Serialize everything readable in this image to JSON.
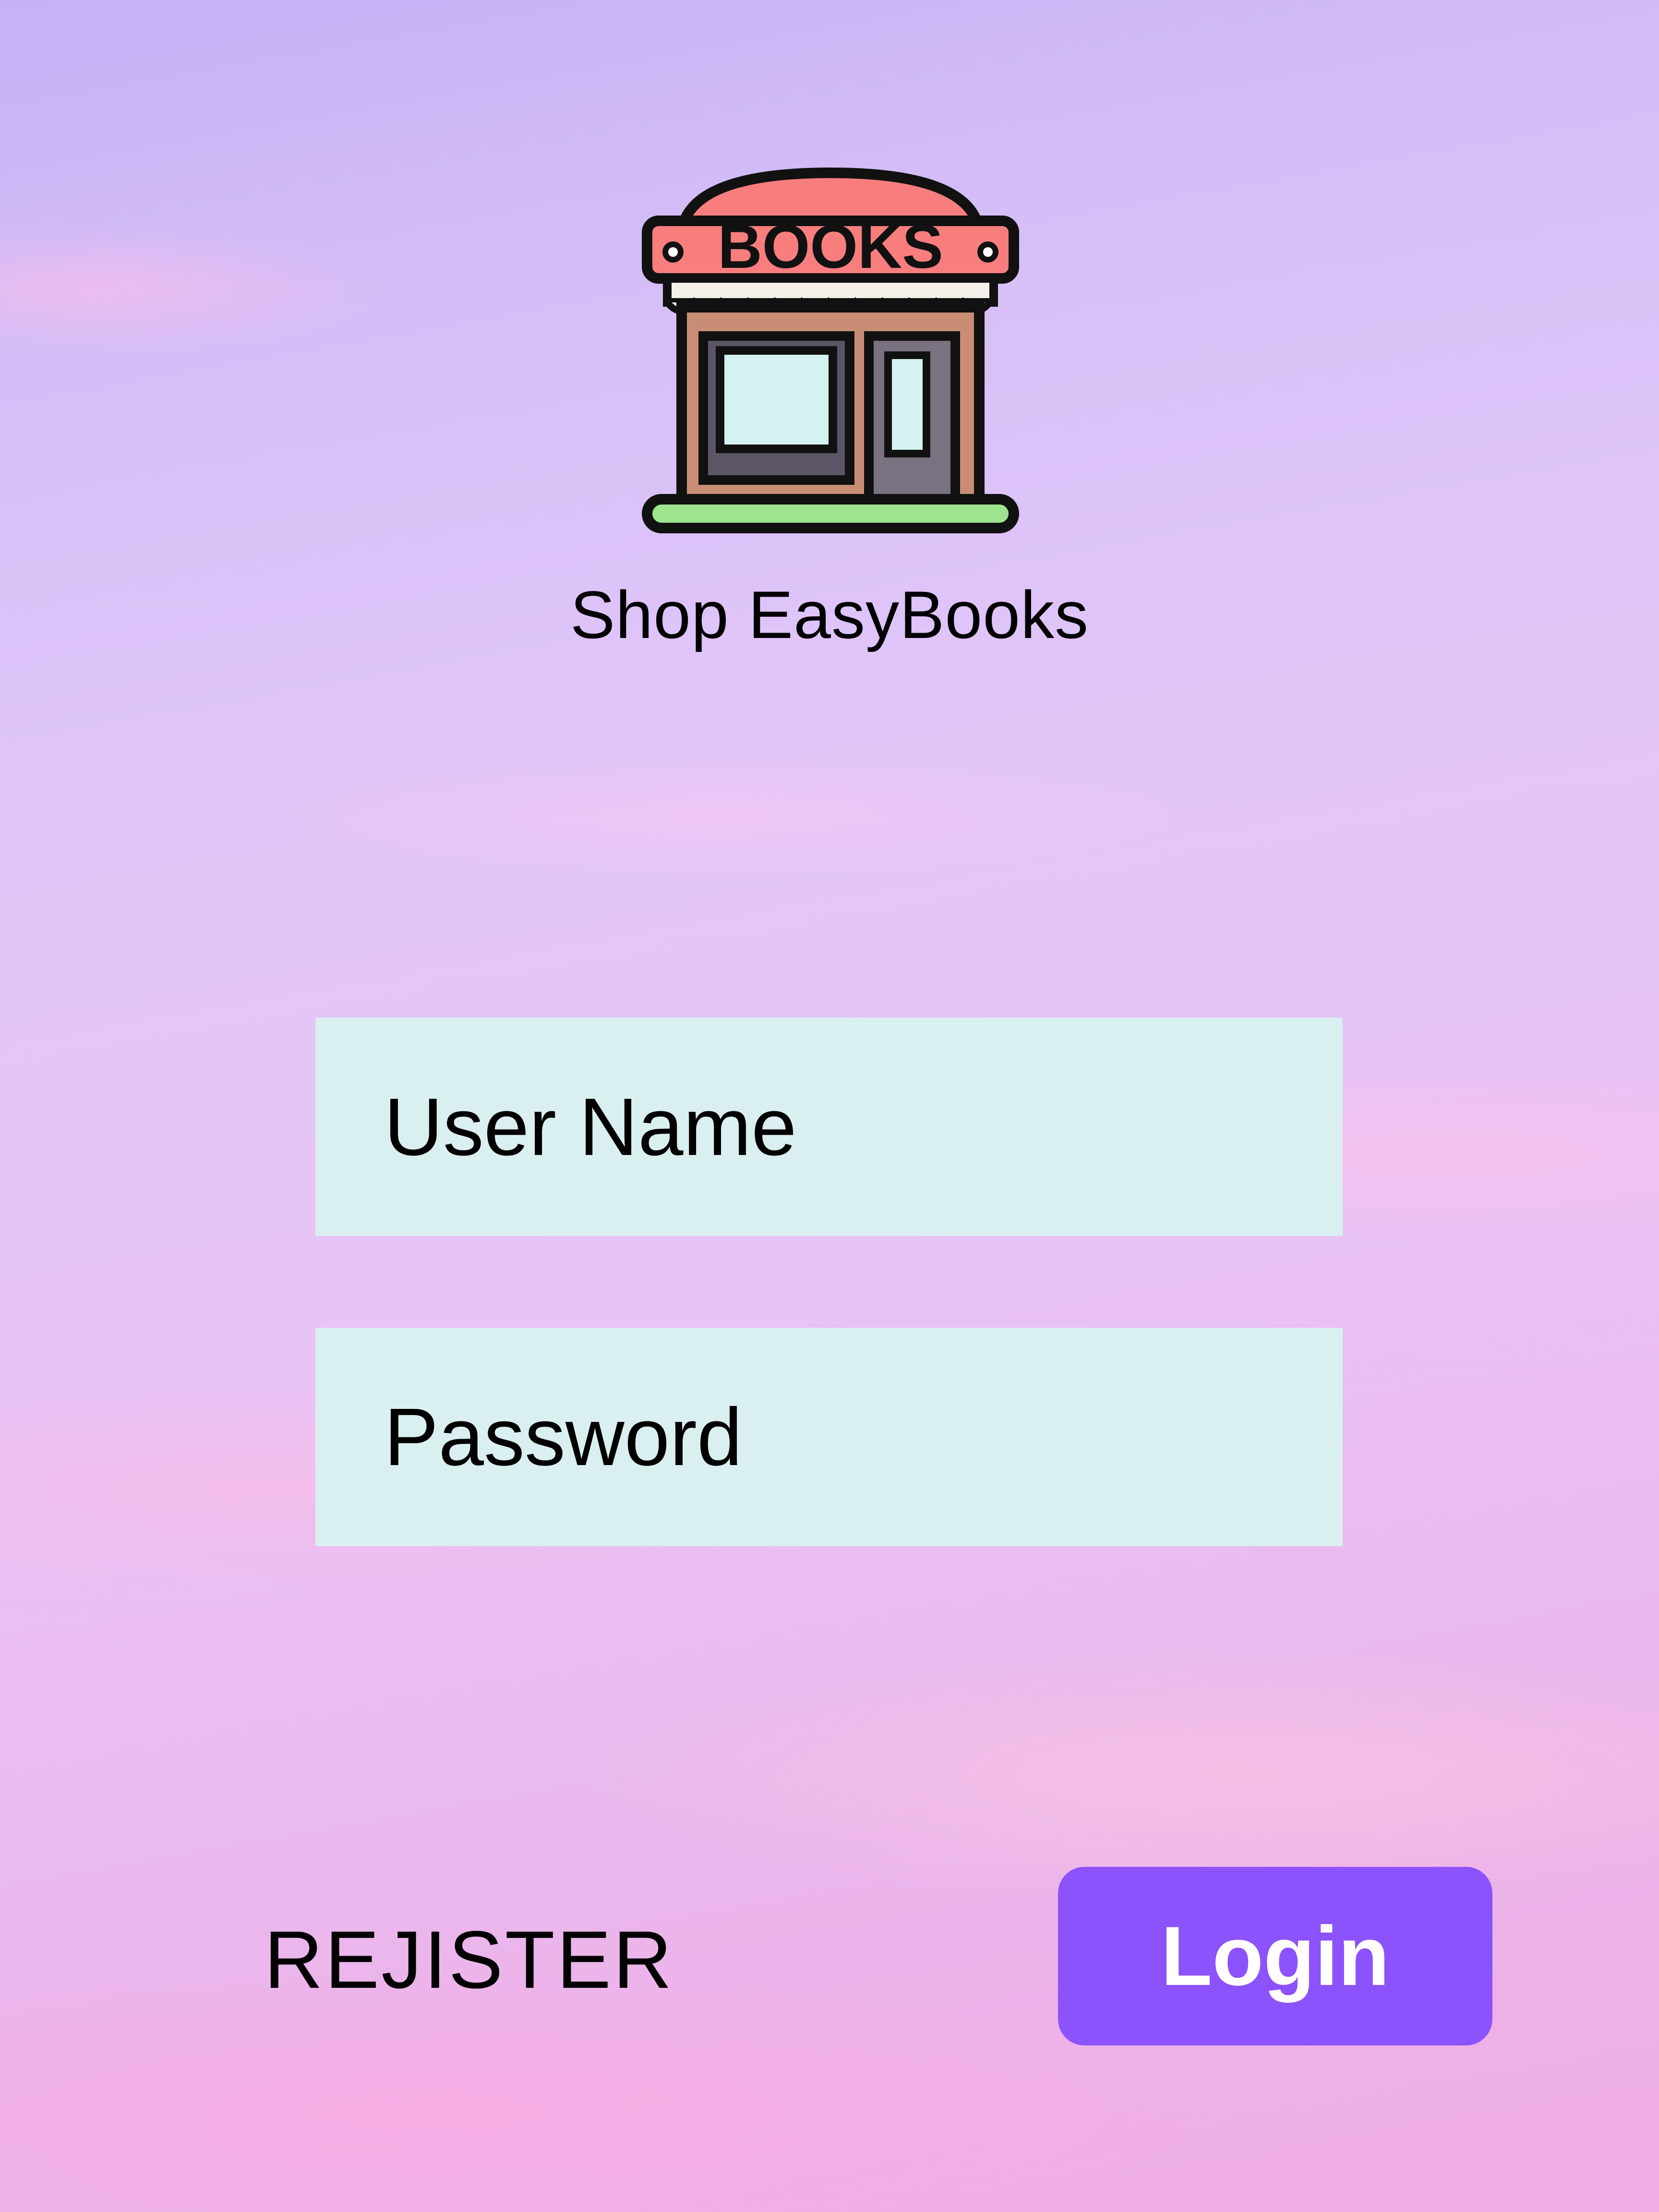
{
  "logo": {
    "icon": "bookstore-icon",
    "sign_text": "BOOKS"
  },
  "brand": {
    "name": "Shop EasyBooks"
  },
  "form": {
    "username_placeholder": "User Name",
    "password_placeholder": "Password"
  },
  "actions": {
    "register_label": "REJISTER",
    "login_label": "Login"
  },
  "colors": {
    "login_button": "#8c52fb",
    "input_background": "#daeff0",
    "sign": "#f87e7e"
  }
}
